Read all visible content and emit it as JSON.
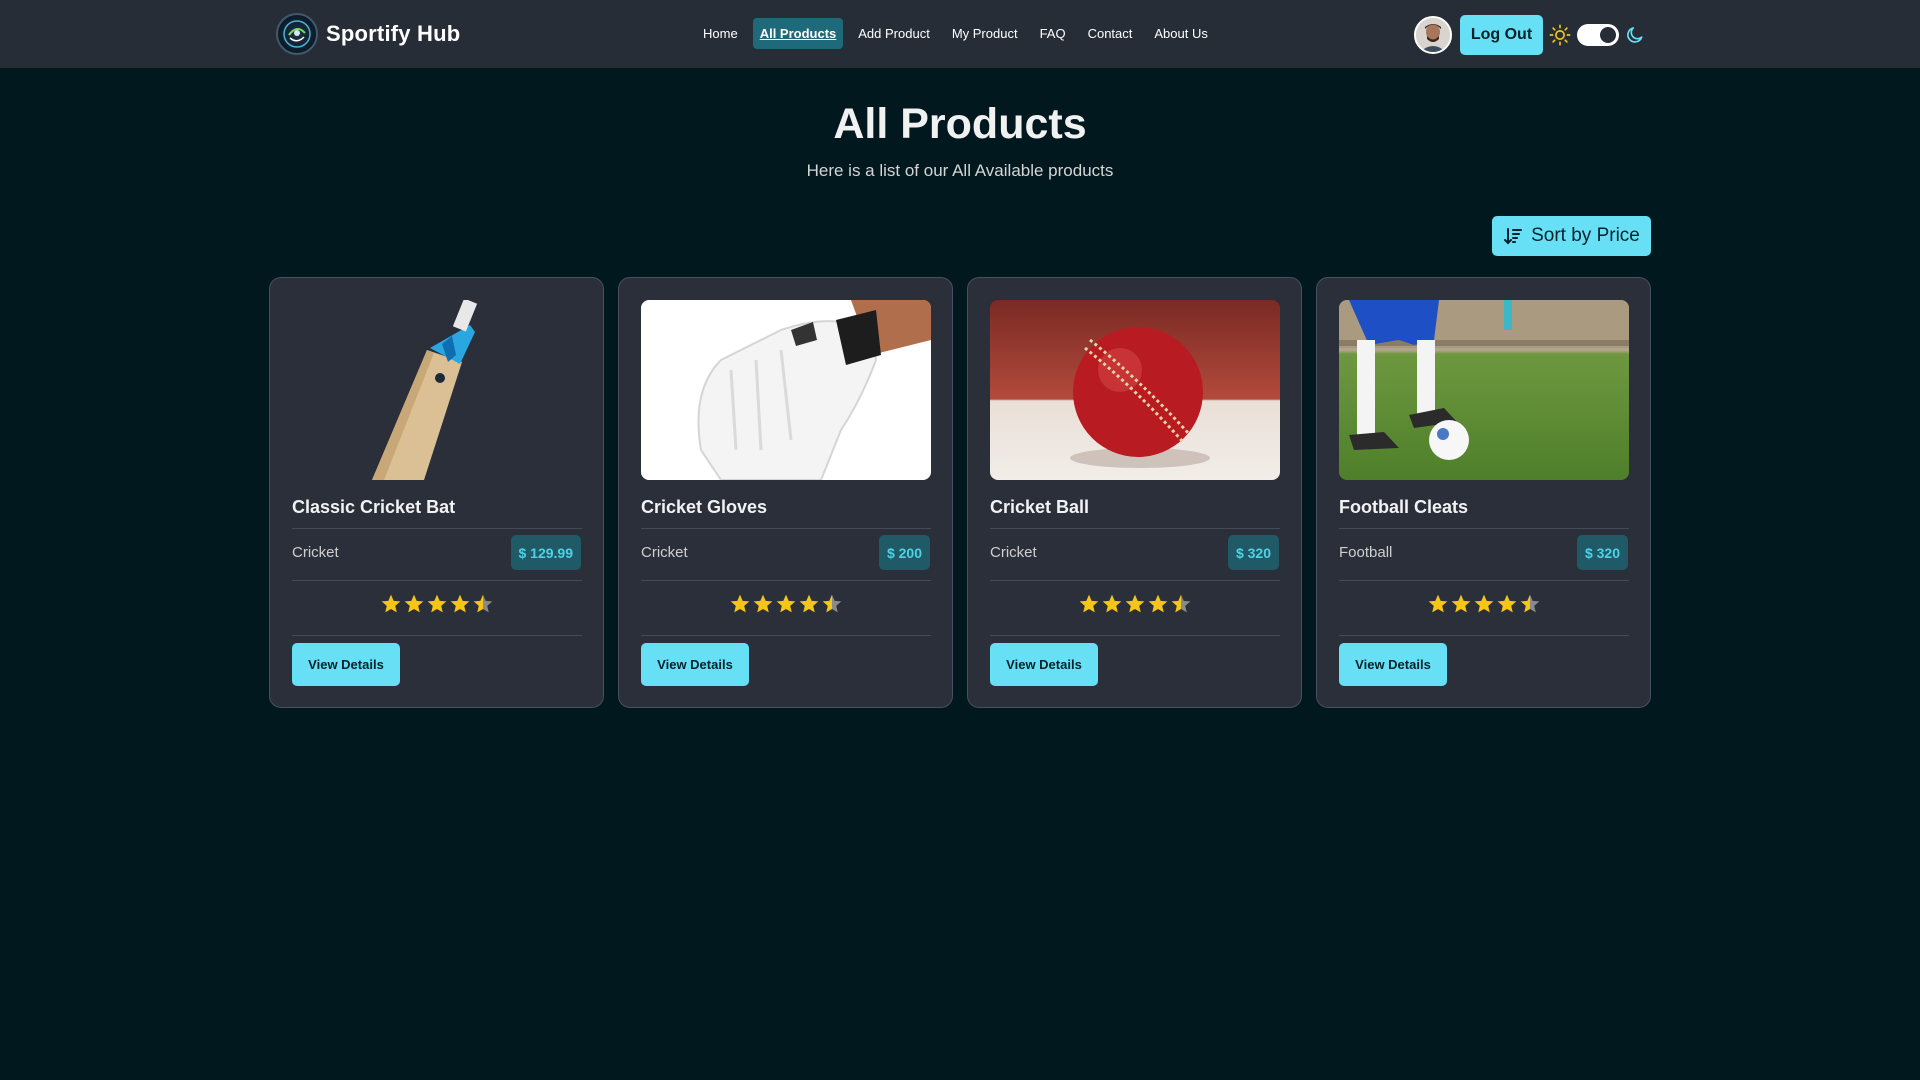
{
  "brand": {
    "name": "Sportify Hub"
  },
  "nav": {
    "links": [
      "Home",
      "All Products",
      "Add Product",
      "My Product",
      "FAQ",
      "Contact",
      "About Us"
    ],
    "active": "All Products",
    "logout_label": "Log Out",
    "theme_dark": true
  },
  "page": {
    "title": "All Products",
    "subtitle": "Here is a list of our All Available products",
    "sort_label": "Sort by Price"
  },
  "products": [
    {
      "name": "Classic Cricket Bat",
      "category": "Cricket",
      "price": "$ 129.99",
      "rating": 4.5,
      "button": "View Details"
    },
    {
      "name": "Cricket Gloves",
      "category": "Cricket",
      "price": "$ 200",
      "rating": 4.5,
      "button": "View Details"
    },
    {
      "name": "Cricket Ball",
      "category": "Cricket",
      "price": "$ 320",
      "rating": 4.5,
      "button": "View Details"
    },
    {
      "name": "Football Cleats",
      "category": "Football",
      "price": "$ 320",
      "rating": 4.5,
      "button": "View Details"
    }
  ],
  "colors": {
    "background": "#02181f",
    "navbar": "#262d37",
    "accent": "#67dff5",
    "card": "#2a2f3a",
    "price_bg": "#1f5a66",
    "price_text": "#4fd2e6",
    "star": "#f5c518"
  },
  "icons": {
    "sort": "sort-descending-icon",
    "theme_light": "sun-icon",
    "theme_dark": "moon-icon",
    "rating": "star-icon"
  }
}
